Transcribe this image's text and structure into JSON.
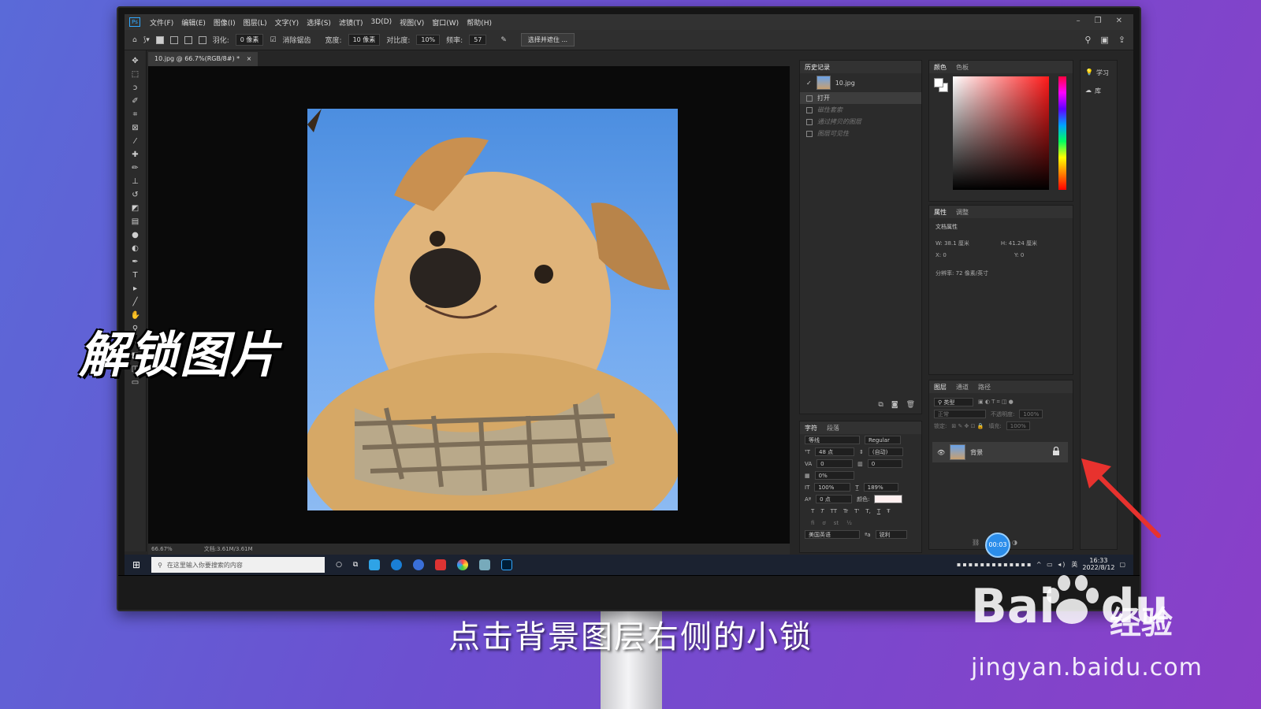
{
  "app": {
    "logo": "Ps",
    "menu": [
      "文件(F)",
      "编辑(E)",
      "图像(I)",
      "图层(L)",
      "文字(Y)",
      "选择(S)",
      "滤镜(T)",
      "3D(D)",
      "视图(V)",
      "窗口(W)",
      "帮助(H)"
    ],
    "window_controls": [
      "–",
      "❐",
      "✕"
    ]
  },
  "options": {
    "feather_label": "羽化:",
    "feather_value": "0 像素",
    "antialias_label": "消除锯齿",
    "width_label": "宽度:",
    "width_value": "10 像素",
    "contrast_label": "对比度:",
    "contrast_value": "10%",
    "frequency_label": "频率:",
    "frequency_value": "57",
    "select_mask_button": "选择并遮住 ..."
  },
  "document": {
    "tab_label": "10.jpg @ 66.7%(RGB/8#) *",
    "tab_close": "×",
    "zoom": "66.67%",
    "doc_size": "文档:3.61M/3.61M"
  },
  "history_panel": {
    "tab": "历史记录",
    "snapshot": "10.jpg",
    "items": [
      {
        "label": "打开",
        "state": "sel"
      },
      {
        "label": "磁性套索",
        "state": "dim"
      },
      {
        "label": "通过拷贝的图层",
        "state": "dim"
      },
      {
        "label": "图层可见性",
        "state": "dim"
      }
    ]
  },
  "color_panel": {
    "tabs": [
      "颜色",
      "色板"
    ],
    "fg_color": "#ffffff",
    "bg_color": "#ffffff"
  },
  "learn_panel": {
    "learn_label": "学习",
    "library_label": "库"
  },
  "properties_panel": {
    "tabs": [
      "属性",
      "调整"
    ],
    "section": "文档属性",
    "w": "W: 38.1 厘米",
    "h": "H: 41.24 厘米",
    "x": "X: 0",
    "y": "Y: 0",
    "resolution": "分辨率: 72 像素/英寸"
  },
  "character_panel": {
    "tabs": [
      "字符",
      "段落"
    ],
    "font_family": "等线",
    "font_style": "Regular",
    "font_size": "48 点",
    "leading": "(自动)",
    "kerning": "0",
    "tracking": "0",
    "scale_pct": "0%",
    "vertical_scale": "100%",
    "horizontal_scale": "189%",
    "baseline": "0 点",
    "color_label": "颜色:",
    "language": "美国英语",
    "antialias": "锐利",
    "style_buttons": [
      "T",
      "T",
      "TT",
      "Tr",
      "T'",
      "T,",
      "T",
      "Ŧ"
    ]
  },
  "layers_panel": {
    "tabs": [
      "图层",
      "通道",
      "路径"
    ],
    "filter_label": "类型",
    "blend_mode": "正常",
    "opacity_label": "不透明度:",
    "opacity_value": "100%",
    "lock_label": "锁定:",
    "fill_label": "填充:",
    "fill_value": "100%",
    "layer_name": "背景"
  },
  "taskbar": {
    "search_placeholder": "在这里输入你要搜索的内容",
    "time": "16:33",
    "date": "2022/8/12",
    "ime_label": "英"
  },
  "timer_badge": "00:03",
  "overlay_title": "解锁图片",
  "caption": "点击背景图层右侧的小锁",
  "watermark": {
    "logo": "Bai",
    "logo2": "du",
    "brand": "经验",
    "url": "jingyan.baidu.com"
  },
  "colors": {
    "accent": "#31a8ff",
    "arrow": "#e8322e"
  }
}
